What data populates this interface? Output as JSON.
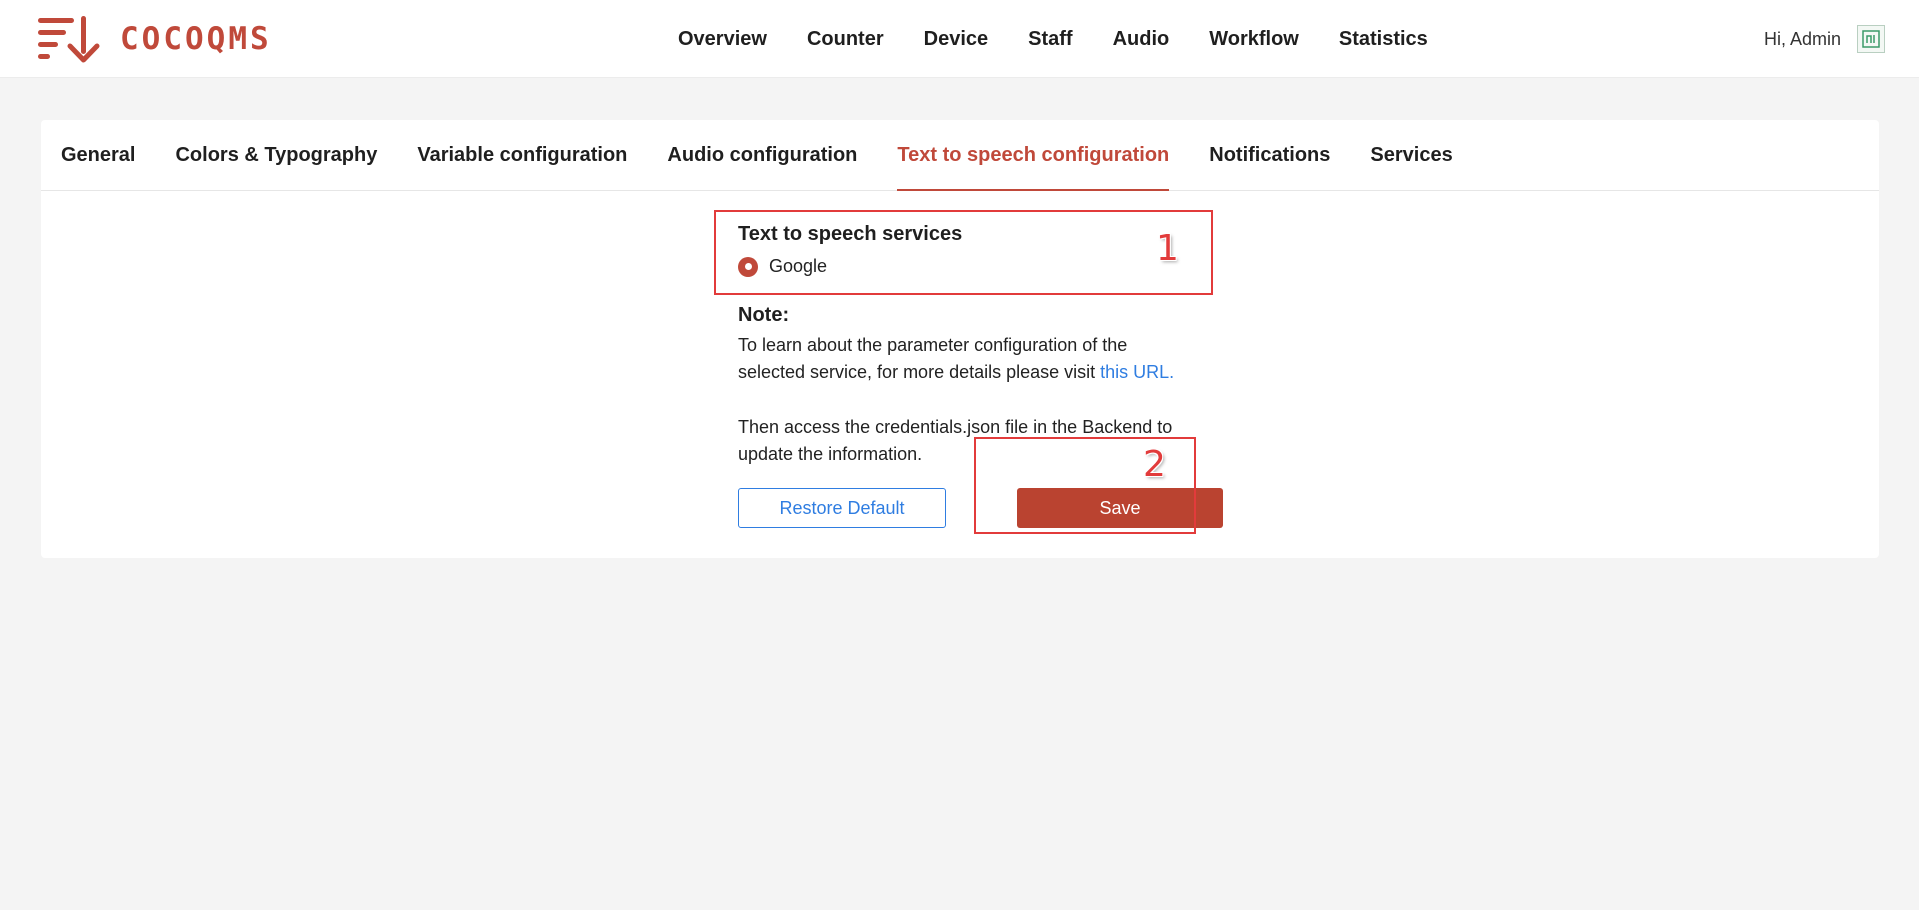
{
  "header": {
    "logo_text": "COCOQMS",
    "nav": [
      "Overview",
      "Counter",
      "Device",
      "Staff",
      "Audio",
      "Workflow",
      "Statistics"
    ],
    "greeting": "Hi, Admin",
    "avatar_icon": "avatar-icon"
  },
  "settings": {
    "tabs": [
      "General",
      "Colors & Typography",
      "Variable configuration",
      "Audio configuration",
      "Text to speech configuration",
      "Notifications",
      "Services"
    ],
    "active_tab": "Text to speech configuration",
    "tts": {
      "services_label": "Text to speech services",
      "selected_service": "Google",
      "note_title": "Note:",
      "note_line1": "To learn about the parameter configuration of the",
      "note_line2_prefix": "selected service, for more details please visit ",
      "note_link": "this URL.",
      "note_line3": "Then access the credentials.json file in the Backend to",
      "note_line4": "update the information.",
      "restore_label": "Restore Default",
      "save_label": "Save"
    }
  },
  "annotations": [
    {
      "number": "1",
      "target": "Text to speech services"
    },
    {
      "number": "2",
      "target": "Save"
    }
  ],
  "colors": {
    "brand": "#c0493a",
    "save_button": "#ba4330",
    "link": "#2f7de1",
    "annotation": "#e23b3b"
  }
}
